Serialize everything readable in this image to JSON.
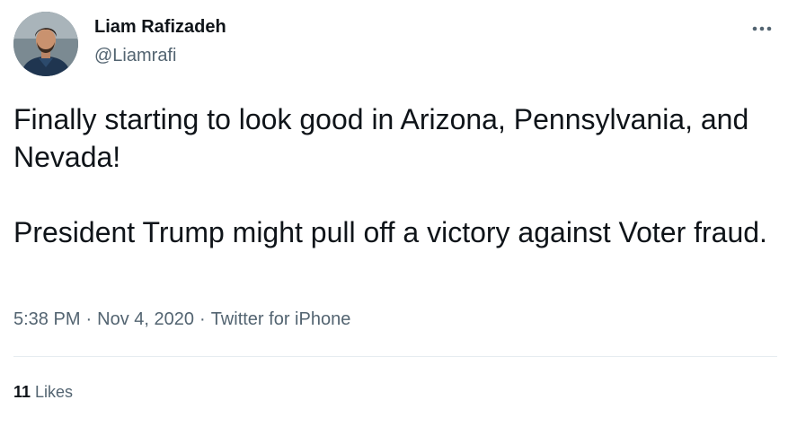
{
  "author": {
    "display_name": "Liam Rafizadeh",
    "handle": "@Liamrafi"
  },
  "tweet": {
    "paragraphs": [
      "Finally starting to look good in Arizona, Pennsylvania, and Nevada!",
      "President Trump might pull off a victory against Voter fraud."
    ]
  },
  "meta": {
    "time": "5:38 PM",
    "separator1": "·",
    "date": "Nov 4, 2020",
    "separator2": "·",
    "source": "Twitter for iPhone"
  },
  "stats": {
    "likes_count": "11",
    "likes_label": "Likes"
  },
  "icons": {
    "more": "more-horizontal-icon",
    "avatar": "profile-photo"
  },
  "colors": {
    "text_primary": "#0f1419",
    "text_secondary": "#536471",
    "divider": "#e6ecf0"
  }
}
